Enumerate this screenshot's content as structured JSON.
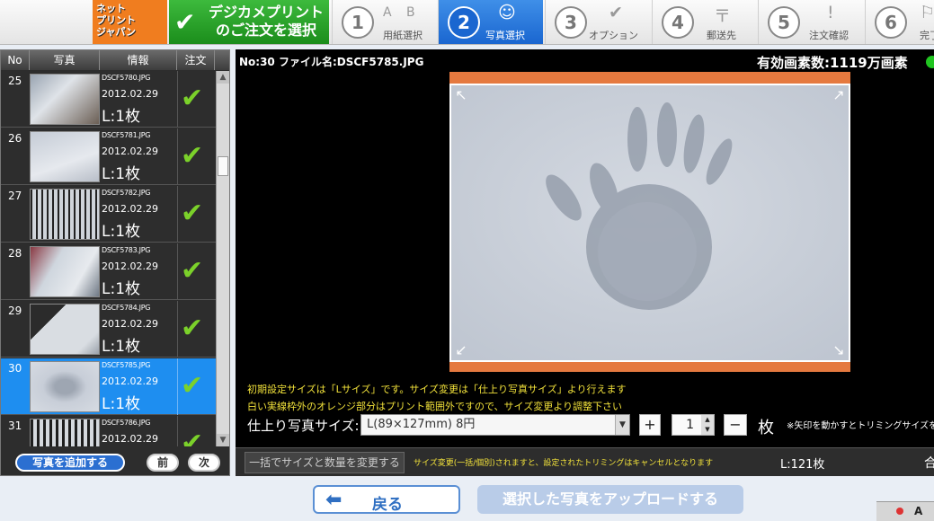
{
  "logo": {
    "line1": "ネット",
    "line2": "プリント",
    "line3": "ジャパン"
  },
  "current_step": {
    "line1": "デジカメプリント",
    "line2": "のご注文を選択"
  },
  "steps": [
    {
      "num": "1",
      "icon": "A B",
      "label": "用紙選択"
    },
    {
      "num": "2",
      "icon": "☺",
      "label": "写真選択"
    },
    {
      "num": "3",
      "icon": "✔",
      "label": "オプション"
    },
    {
      "num": "4",
      "icon": "〒",
      "label": "郵送先"
    },
    {
      "num": "5",
      "icon": "!",
      "label": "注文確認"
    },
    {
      "num": "6",
      "icon": "⚐",
      "label": "完了"
    }
  ],
  "list": {
    "headers": [
      "No",
      "写真",
      "情報",
      "注文"
    ],
    "rows": [
      {
        "no": "25",
        "file": "DSCF5780.JPG",
        "date": "2012.02.29",
        "qty": "L:1枚"
      },
      {
        "no": "26",
        "file": "DSCF5781.JPG",
        "date": "2012.02.29",
        "qty": "L:1枚"
      },
      {
        "no": "27",
        "file": "DSCF5782.JPG",
        "date": "2012.02.29",
        "qty": "L:1枚"
      },
      {
        "no": "28",
        "file": "DSCF5783.JPG",
        "date": "2012.02.29",
        "qty": "L:1枚"
      },
      {
        "no": "29",
        "file": "DSCF5784.JPG",
        "date": "2012.02.29",
        "qty": "L:1枚"
      },
      {
        "no": "30",
        "file": "DSCF5785.JPG",
        "date": "2012.02.29",
        "qty": "L:1枚"
      },
      {
        "no": "31",
        "file": "DSCF5786.JPG",
        "date": "2012.02.29",
        "qty": ""
      }
    ],
    "add_button": "写真を追加する",
    "prev_button": "前",
    "next_button": "次"
  },
  "preview": {
    "file_info": "No:30 ファイル名:DSCF5785.JPG",
    "pixels": "有効画素数:1119万画素",
    "hint1": "初期設定サイズは「Lサイズ」です。サイズ変更は「仕上り写真サイズ」より行えます",
    "hint2": "白い実線枠外のオレンジ部分はプリント範囲外ですので、サイズ変更より調整下さい",
    "size_label": "仕上り写真サイズ:",
    "size_value": "L(89×127mm) 8円",
    "plus": "+",
    "qty": "1",
    "minus": "−",
    "unit": "枚",
    "note": "※矢印を動かすとトリミングサイズを"
  },
  "bulk": {
    "button": "一括でサイズと数量を変更する",
    "note": "サイズ変更(一括/個別)されますと、設定されたトリミングはキャンセルとなります",
    "total": "L:121枚",
    "end": "合"
  },
  "footer": {
    "back": "戻る",
    "upload": "選択した写真をアップロードする"
  },
  "taskbar": {
    "ime": "A"
  }
}
